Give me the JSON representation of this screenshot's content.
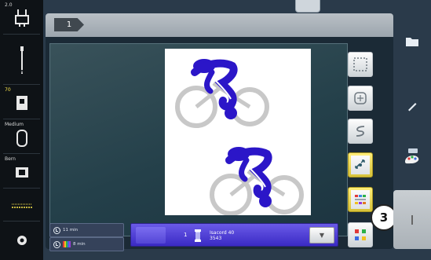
{
  "left_column": {
    "cells": [
      {
        "label": "2.0",
        "icon": "presser-foot-icon"
      },
      {
        "label": "",
        "icon": "needle-icon"
      },
      {
        "label": "70",
        "icon": "needle-plate-icon"
      },
      {
        "label": "Medium",
        "icon": "hoop-icon"
      },
      {
        "label": "Bern",
        "icon": "thread-tension-icon"
      },
      {
        "label": "",
        "icon": "stitch-icon"
      },
      {
        "label": "",
        "icon": "settings-icon"
      }
    ]
  },
  "header": {
    "button_label": "1"
  },
  "status": {
    "stitch_time": "11 min",
    "color_time": "8 min"
  },
  "color_bar": {
    "number": "1",
    "thread_name": "Isacord 40",
    "thread_code": "3543"
  },
  "callout": {
    "label": "3"
  },
  "tools": [
    {
      "name": "select-area-tool",
      "icon": "dotted-rectangle-icon",
      "active": false
    },
    {
      "name": "center-tool",
      "icon": "center-icon",
      "active": false
    },
    {
      "name": "stitch-order-tool",
      "icon": "s-curve-icon",
      "active": false
    },
    {
      "name": "move-tool",
      "icon": "move-arrows-icon",
      "active": true
    },
    {
      "name": "color-resequence-tool",
      "icon": "color-sequence-icon",
      "active": true
    },
    {
      "name": "color-tool",
      "icon": "color-dots-icon",
      "active": false
    }
  ],
  "right_panel": [
    {
      "name": "file-button",
      "icon": "folder-icon"
    },
    {
      "name": "edit-button",
      "icon": "pencil-icon"
    },
    {
      "name": "color-palette-button",
      "icon": "palette-icon"
    },
    {
      "name": "stitch-button",
      "icon": "stitch-icon"
    }
  ],
  "colors": {
    "screen_bg": "#1b2a36",
    "accent_yellow": "#ffe94d",
    "motif_blue": "#2b16c8",
    "wheel_gray": "#c8c8c8",
    "color_bar_blue": "#4a3ad8"
  }
}
